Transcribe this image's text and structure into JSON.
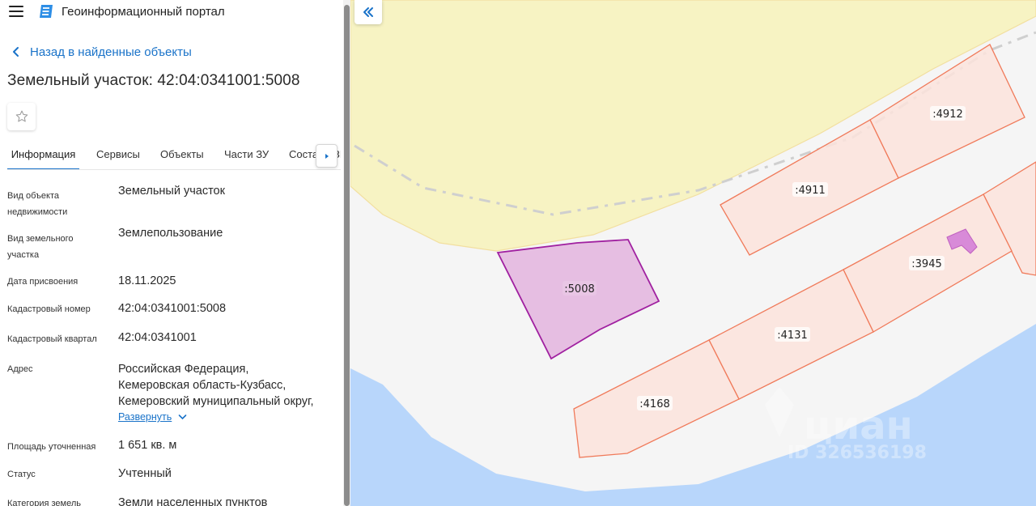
{
  "app": {
    "title": "Геоинформационный портал"
  },
  "nav": {
    "back_label": "Назад в найденные объекты"
  },
  "page": {
    "title": "Земельный участок: 42:04:0341001:5008"
  },
  "tabs": [
    {
      "label": "Информация",
      "active": true
    },
    {
      "label": "Сервисы",
      "active": false
    },
    {
      "label": "Объекты",
      "active": false
    },
    {
      "label": "Части ЗУ",
      "active": false
    },
    {
      "label": "Состав ЕЗП",
      "active": false
    }
  ],
  "properties": [
    {
      "label_lines": [
        "Вид объекта",
        "недвижимости"
      ],
      "value_lines": [
        "Земельный участок"
      ]
    },
    {
      "label_lines": [
        "Вид земельного",
        "участка"
      ],
      "value_lines": [
        "Землепользование"
      ]
    },
    {
      "label_lines": [
        "Дата присвоения"
      ],
      "value_lines": [
        "18.11.2025"
      ]
    },
    {
      "label_lines": [
        "Кадастровый номер"
      ],
      "value_lines": [
        "42:04:0341001:5008"
      ]
    },
    {
      "label_lines": [
        "Кадастровый квартал"
      ],
      "value_lines": [
        "42:04:0341001"
      ]
    },
    {
      "label_lines": [
        "Адрес"
      ],
      "value_lines": [
        "Российская Федерация,",
        "Кемеровская область-Кузбасс,",
        "Кемеровский муниципальный округ,"
      ]
    },
    {
      "label_lines": [
        "Площадь уточненная"
      ],
      "value_lines": [
        "1 651 кв. м"
      ]
    },
    {
      "label_lines": [
        "Статус"
      ],
      "value_lines": [
        "Учтенный"
      ]
    },
    {
      "label_lines": [
        "Категория земель"
      ],
      "value_lines": [
        "Земли населенных пунктов"
      ]
    }
  ],
  "address_expand_label": "Развернуть",
  "map": {
    "parcels": [
      {
        "label": ":5008",
        "selected": true
      },
      {
        "label": ":4912",
        "selected": false
      },
      {
        "label": ":4911",
        "selected": false
      },
      {
        "label": ":3945",
        "selected": false
      },
      {
        "label": ":4131",
        "selected": false
      },
      {
        "label": ":4168",
        "selected": false
      }
    ],
    "watermark": {
      "brand": "циан",
      "id": "ID 326536198"
    }
  },
  "icons": {
    "menu": "hamburger-menu-icon",
    "logo": "portal-logo-icon",
    "back": "chevron-left-icon",
    "favorite": "star-outline-icon",
    "tabs_next": "triangle-right-icon",
    "expand": "chevron-down-icon",
    "collapse": "double-chevron-left-icon"
  },
  "colors": {
    "link": "#1a73c9",
    "selected_parcel_fill": "#e4b8e0",
    "selected_parcel_stroke": "#a020a0",
    "parcel_fill": "#fbe3dc",
    "parcel_stroke": "#f07a5a",
    "water": "#b8d6fb",
    "land_zone": "#f7f3c3"
  }
}
